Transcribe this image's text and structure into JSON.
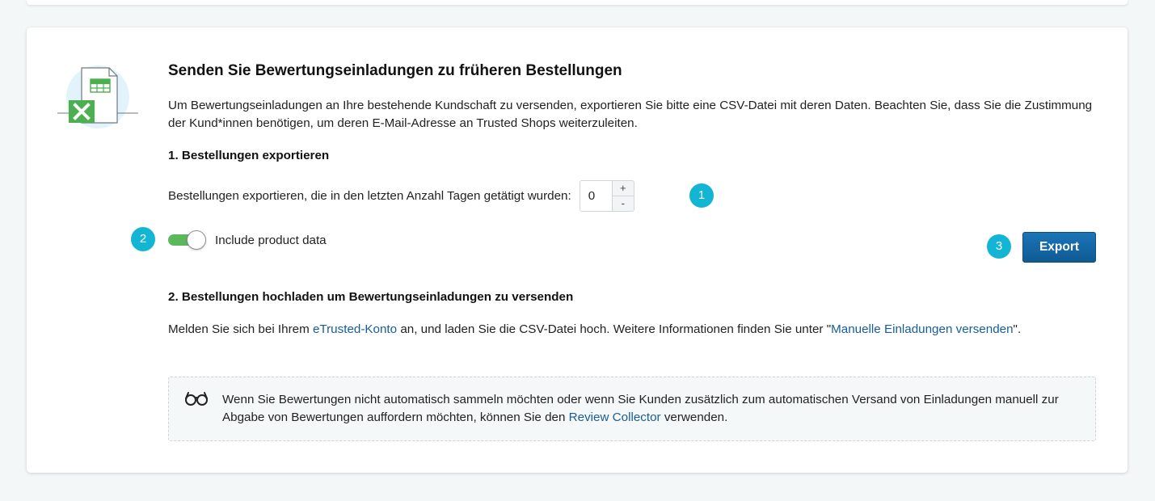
{
  "card": {
    "title": "Senden Sie Bewertungseinladungen zu früheren Bestellungen",
    "intro": "Um Bewertungseinladungen an Ihre bestehende Kundschaft zu versenden, exportieren Sie bitte eine CSV-Datei mit deren Daten. Beachten Sie, dass Sie die Zustimmung der Kund*innen benötigen, um deren E-Mail-Adresse an Trusted Shops weiterzuleiten."
  },
  "step1": {
    "heading": "1. Bestellungen exportieren",
    "days_label": "Bestellungen exportieren, die in den letzten Anzahl Tagen getätigt wurden:",
    "days_value": "0",
    "increment_label": "+",
    "decrement_label": "-",
    "toggle_label": "Include product data",
    "toggle_on": true,
    "export_label": "Export"
  },
  "badges": [
    "1",
    "2",
    "3"
  ],
  "step2": {
    "heading": "2. Bestellungen hochladen um Bewertungseinladungen zu versenden",
    "text_before": "Melden Sie sich bei Ihrem ",
    "link1": "eTrusted-Konto",
    "text_middle": " an, und laden Sie die CSV-Datei hoch. Weitere Informationen finden Sie unter \"",
    "link2": "Manuelle Einladungen versenden",
    "text_after": "\"."
  },
  "tip": {
    "icon": "glasses-icon",
    "text_before": "Wenn Sie Bewertungen nicht automatisch sammeln möchten oder wenn Sie Kunden zusätzlich zum automatischen Versand von Einladungen manuell zur Abgabe von Bewertungen auffordern möchten, können Sie den ",
    "link": "Review Collector",
    "text_after": " verwenden."
  },
  "colors": {
    "accent_badge": "#13b5d4",
    "toggle_on": "#5cb85c",
    "button": "#1b6aa8",
    "link": "#185d97",
    "excel_green": "#4caf50"
  }
}
